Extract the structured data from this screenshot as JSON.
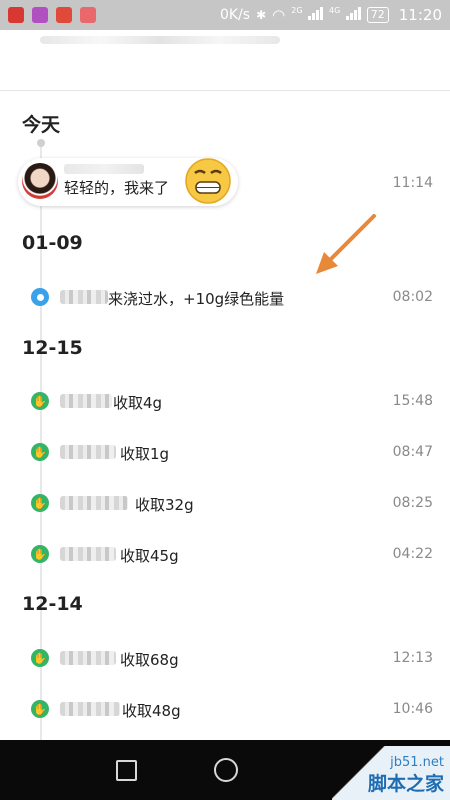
{
  "status_bar": {
    "speed": "0K/s",
    "net1": "2G",
    "net2": "4G",
    "battery": "72",
    "time": "11:20",
    "app_icons": [
      {
        "name": "app-icon-1",
        "color": "#d8382f"
      },
      {
        "name": "app-icon-2",
        "color": "#b150c0"
      },
      {
        "name": "app-icon-3",
        "color": "#e04a3a"
      },
      {
        "name": "app-icon-4",
        "color": "#e8686b"
      }
    ]
  },
  "today": {
    "label": "今天",
    "message": {
      "text": "轻轻的，我来了",
      "time": "11:14",
      "emoji": "grinning-face-icon"
    }
  },
  "sections": [
    {
      "date": "01-09",
      "items": [
        {
          "icon": "water-drop-icon",
          "color": "#3ba1e9",
          "text": "来浇过水，+10g绿色能量",
          "time": "08:02"
        }
      ]
    },
    {
      "date": "12-15",
      "items": [
        {
          "icon": "hand-icon",
          "color": "#34b565",
          "text": "收取4g",
          "time": "15:48"
        },
        {
          "icon": "hand-icon",
          "color": "#34b565",
          "text": "收取1g",
          "time": "08:47"
        },
        {
          "icon": "hand-icon",
          "color": "#34b565",
          "text": "收取32g",
          "time": "08:25"
        },
        {
          "icon": "hand-icon",
          "color": "#34b565",
          "text": "收取45g",
          "time": "04:22"
        }
      ]
    },
    {
      "date": "12-14",
      "items": [
        {
          "icon": "hand-icon",
          "color": "#34b565",
          "text": "收取68g",
          "time": "12:13"
        },
        {
          "icon": "hand-icon",
          "color": "#34b565",
          "text": "收取48g",
          "time": "10:46"
        }
      ]
    }
  ],
  "annotation": {
    "color": "#e8893a"
  },
  "watermark": {
    "site": "jb51.net",
    "name": "脚本之家"
  }
}
